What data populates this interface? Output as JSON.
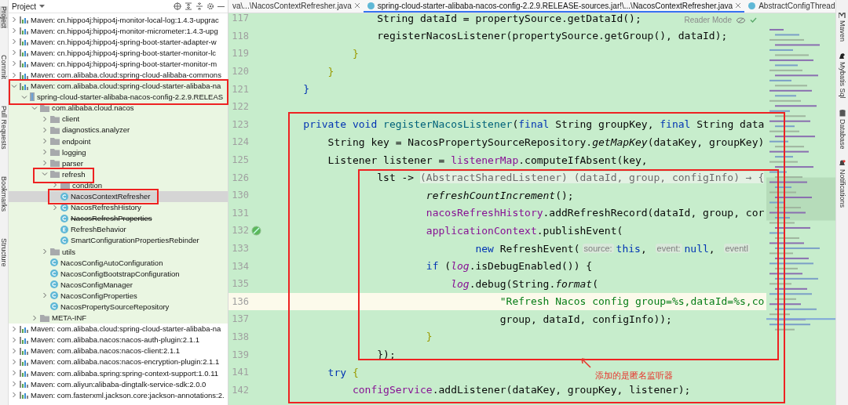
{
  "left_tool_strip": [
    {
      "label": "Project",
      "selected": true
    },
    {
      "label": "Commit",
      "selected": false
    },
    {
      "label": "Pull Requests",
      "selected": false
    },
    {
      "label": "Bookmarks",
      "selected": false
    },
    {
      "label": "Structure",
      "selected": false
    }
  ],
  "project_panel": {
    "title": "Project",
    "tree": [
      {
        "label": "Maven: cn.hippo4j:hippo4j-monitor-local-log:1.4.3-upgrac",
        "kind": "library",
        "expanded": false,
        "selected": false
      },
      {
        "label": "Maven: cn.hippo4j:hippo4j-monitor-micrometer:1.4.3-upg",
        "kind": "library",
        "expanded": false,
        "selected": false
      },
      {
        "label": "Maven: cn.hippo4j:hippo4j-spring-boot-starter-adapter-w",
        "kind": "library",
        "expanded": false,
        "selected": false
      },
      {
        "label": "Maven: cn.hippo4j:hippo4j-spring-boot-starter-monitor-lc",
        "kind": "library",
        "expanded": false,
        "selected": false
      },
      {
        "label": "Maven: cn.hippo4j:hippo4j-spring-boot-starter-monitor-m",
        "kind": "library",
        "expanded": false,
        "selected": false
      },
      {
        "label": "Maven: com.alibaba.cloud:spring-cloud-alibaba-commons",
        "kind": "library",
        "expanded": false,
        "selected": false
      },
      {
        "label": "Maven: com.alibaba.cloud:spring-cloud-starter-alibaba-na",
        "kind": "library",
        "expanded": true,
        "selected": false,
        "children": [
          {
            "label": "spring-cloud-starter-alibaba-nacos-config-2.2.9.RELEAS",
            "kind": "jar",
            "expanded": true,
            "selected": false,
            "children": [
              {
                "label": "com.alibaba.cloud.nacos",
                "kind": "package",
                "expanded": true,
                "selected": false,
                "children": [
                  {
                    "label": "client",
                    "kind": "package",
                    "expanded": false,
                    "selected": false
                  },
                  {
                    "label": "diagnostics.analyzer",
                    "kind": "package",
                    "expanded": false,
                    "selected": false
                  },
                  {
                    "label": "endpoint",
                    "kind": "package",
                    "expanded": false,
                    "selected": false
                  },
                  {
                    "label": "logging",
                    "kind": "package",
                    "expanded": false,
                    "selected": false
                  },
                  {
                    "label": "parser",
                    "kind": "package",
                    "expanded": false,
                    "selected": false
                  },
                  {
                    "label": "refresh",
                    "kind": "package",
                    "expanded": true,
                    "selected": false,
                    "children": [
                      {
                        "label": "condition",
                        "kind": "package",
                        "expanded": false,
                        "selected": false
                      },
                      {
                        "label": "NacosContextRefresher",
                        "kind": "class",
                        "selected": true
                      },
                      {
                        "label": "NacosRefreshHistory",
                        "kind": "class",
                        "expanded": false,
                        "selected": false
                      },
                      {
                        "label": "NacosRefreshProperties",
                        "kind": "class",
                        "deprecated": true,
                        "selected": false
                      },
                      {
                        "label": "RefreshBehavior",
                        "kind": "enum",
                        "selected": false
                      },
                      {
                        "label": "SmartConfigurationPropertiesRebinder",
                        "kind": "class",
                        "selected": false
                      }
                    ]
                  },
                  {
                    "label": "utils",
                    "kind": "package",
                    "expanded": false,
                    "selected": false
                  },
                  {
                    "label": "NacosConfigAutoConfiguration",
                    "kind": "class",
                    "selected": false
                  },
                  {
                    "label": "NacosConfigBootstrapConfiguration",
                    "kind": "class",
                    "selected": false
                  },
                  {
                    "label": "NacosConfigManager",
                    "kind": "class",
                    "selected": false
                  },
                  {
                    "label": "NacosConfigProperties",
                    "kind": "class",
                    "expanded": false,
                    "selected": false
                  },
                  {
                    "label": "NacosPropertySourceRepository",
                    "kind": "class",
                    "selected": false
                  }
                ]
              },
              {
                "label": "META-INF",
                "kind": "package",
                "expanded": false,
                "selected": false
              }
            ]
          }
        ]
      },
      {
        "label": "Maven: com.alibaba.cloud:spring-cloud-starter-alibaba-na",
        "kind": "library",
        "expanded": false,
        "selected": false
      },
      {
        "label": "Maven: com.alibaba.nacos:nacos-auth-plugin:2.1.1",
        "kind": "library",
        "expanded": false,
        "selected": false
      },
      {
        "label": "Maven: com.alibaba.nacos:nacos-client:2.1.1",
        "kind": "library",
        "expanded": false,
        "selected": false
      },
      {
        "label": "Maven: com.alibaba.nacos:nacos-encryption-plugin:2.1.1",
        "kind": "library",
        "expanded": false,
        "selected": false
      },
      {
        "label": "Maven: com.alibaba.spring:spring-context-support:1.0.11",
        "kind": "library",
        "expanded": false,
        "selected": false
      },
      {
        "label": "Maven: com.aliyun:alibaba-dingtalk-service-sdk:2.0.0",
        "kind": "library",
        "expanded": false,
        "selected": false
      },
      {
        "label": "Maven: com.fasterxml.jackson.core:jackson-annotations:2.",
        "kind": "library",
        "expanded": false,
        "selected": false
      }
    ]
  },
  "editor": {
    "tabs": [
      {
        "label": "va\\...\\NacosContextRefresher.java",
        "selected": false,
        "closable": true
      },
      {
        "label": "spring-cloud-starter-alibaba-nacos-config-2.2.9.RELEASE-sources.jar!\\...\\NacosContextRefresher.java",
        "selected": true,
        "closable": true
      },
      {
        "label": "AbstractConfigThread",
        "selected": false,
        "closable": false
      }
    ],
    "reader_mode": "Reader Mode",
    "lines": [
      {
        "number": "117",
        "current": false,
        "marker": false,
        "tokens": [
          {
            "text": "                String dataId = propertySource.getDataId();",
            "kind": "plain"
          }
        ]
      },
      {
        "number": "118",
        "current": false,
        "marker": false,
        "tokens": [
          {
            "text": "                registerNacosListener(propertySource.getGroup(), dataId);",
            "kind": "plain"
          }
        ]
      },
      {
        "number": "119",
        "current": false,
        "marker": false,
        "tokens": [
          {
            "text": "            }",
            "kind": "brace"
          }
        ]
      },
      {
        "number": "120",
        "current": false,
        "marker": false,
        "tokens": [
          {
            "text": "        }",
            "kind": "brace"
          }
        ]
      },
      {
        "number": "121",
        "current": false,
        "marker": false,
        "tokens": [
          {
            "text": "    }",
            "kind": "keyword"
          }
        ]
      },
      {
        "number": "122",
        "current": false,
        "marker": false
      },
      {
        "number": "123",
        "current": false,
        "marker": false,
        "tokens": [
          {
            "text": "    private void ",
            "kind": "keyword"
          },
          {
            "text": "registerNacosListener",
            "kind": "method"
          },
          {
            "text": "(",
            "kind": "plain"
          },
          {
            "text": "final ",
            "kind": "keyword"
          },
          {
            "text": "String groupKey, ",
            "kind": "plain"
          },
          {
            "text": "final ",
            "kind": "keyword"
          },
          {
            "text": "String data",
            "kind": "plain"
          }
        ]
      },
      {
        "number": "124",
        "current": false,
        "marker": false,
        "tokens": [
          {
            "text": "        String key = NacosPropertySourceRepository.",
            "kind": "plain"
          },
          {
            "text": "getMapKey",
            "kind": "static"
          },
          {
            "text": "(dataKey, groupKey)",
            "kind": "plain"
          }
        ]
      },
      {
        "number": "125",
        "current": false,
        "marker": false,
        "tokens": [
          {
            "text": "        Listener listener = ",
            "kind": "plain"
          },
          {
            "text": "listenerMap",
            "kind": "field"
          },
          {
            "text": ".computeIfAbsent(key,",
            "kind": "plain"
          }
        ]
      },
      {
        "number": "126",
        "current": false,
        "marker": false,
        "tokens": [
          {
            "text": "                lst -> ",
            "kind": "plain"
          },
          {
            "text": "(AbstractSharedListener) (dataId, group, configInfo) → {",
            "kind": "folded"
          }
        ]
      },
      {
        "number": "130",
        "current": false,
        "marker": false,
        "tokens": [
          {
            "text": "                        refreshCountIncrement",
            "kind": "static"
          },
          {
            "text": "();",
            "kind": "plain"
          }
        ]
      },
      {
        "number": "131",
        "current": false,
        "marker": false,
        "tokens": [
          {
            "text": "                        nacosRefreshHistory",
            "kind": "field"
          },
          {
            "text": ".addRefreshRecord(dataId, group, cor",
            "kind": "plain"
          }
        ]
      },
      {
        "number": "132",
        "current": false,
        "marker": true,
        "tokens": [
          {
            "text": "                        applicationContext",
            "kind": "field"
          },
          {
            "text": ".publishEvent(",
            "kind": "plain"
          }
        ]
      },
      {
        "number": "133",
        "current": false,
        "marker": false,
        "tokens": [
          {
            "text": "                                new ",
            "kind": "keyword"
          },
          {
            "text": "RefreshEvent(",
            "kind": "plain"
          },
          {
            "text": "source:",
            "kind": "hint"
          },
          {
            "text": "this",
            "kind": "keyword"
          },
          {
            "text": ", ",
            "kind": "plain"
          },
          {
            "text": "event:",
            "kind": "hint"
          },
          {
            "text": "null",
            "kind": "keyword"
          },
          {
            "text": ", ",
            "kind": "plain"
          },
          {
            "text": "eventl",
            "kind": "hint"
          }
        ]
      },
      {
        "number": "134",
        "current": false,
        "marker": false,
        "tokens": [
          {
            "text": "                        if ",
            "kind": "keyword"
          },
          {
            "text": "(",
            "kind": "plain"
          },
          {
            "text": "log",
            "kind": "staticfield"
          },
          {
            "text": ".isDebugEnabled()) {",
            "kind": "plain"
          }
        ]
      },
      {
        "number": "135",
        "current": false,
        "marker": false,
        "tokens": [
          {
            "text": "                            log",
            "kind": "staticfield"
          },
          {
            "text": ".debug(String.",
            "kind": "plain"
          },
          {
            "text": "format",
            "kind": "static"
          },
          {
            "text": "(",
            "kind": "plain"
          }
        ]
      },
      {
        "number": "136",
        "current": true,
        "marker": false,
        "tokens": [
          {
            "text": "                                    \"Refresh Nacos config group=%s,dataId=%s,co",
            "kind": "string"
          }
        ]
      },
      {
        "number": "137",
        "current": false,
        "marker": false,
        "tokens": [
          {
            "text": "                                    group, dataId, configInfo));",
            "kind": "plain"
          }
        ]
      },
      {
        "number": "138",
        "current": false,
        "marker": false,
        "tokens": [
          {
            "text": "                        }",
            "kind": "brace"
          }
        ]
      },
      {
        "number": "139",
        "current": false,
        "marker": false,
        "tokens": [
          {
            "text": "                });",
            "kind": "plain"
          }
        ]
      },
      {
        "number": "141",
        "current": false,
        "marker": false,
        "tokens": [
          {
            "text": "        try ",
            "kind": "keyword"
          },
          {
            "text": "{",
            "kind": "brace"
          }
        ]
      },
      {
        "number": "142",
        "current": false,
        "marker": false,
        "tokens": [
          {
            "text": "            configService",
            "kind": "field"
          },
          {
            "text": ".addListener(dataKey, groupKey, listener);",
            "kind": "plain"
          }
        ]
      }
    ]
  },
  "right_tool_strip": [
    {
      "label": "Maven",
      "kind": "maven"
    },
    {
      "label": "Mybatis Sql",
      "kind": "bird"
    },
    {
      "label": "Database",
      "kind": "database"
    },
    {
      "label": "Notifications",
      "kind": "bell"
    }
  ],
  "annotation": {
    "note": "添加的是匿名监听器"
  }
}
